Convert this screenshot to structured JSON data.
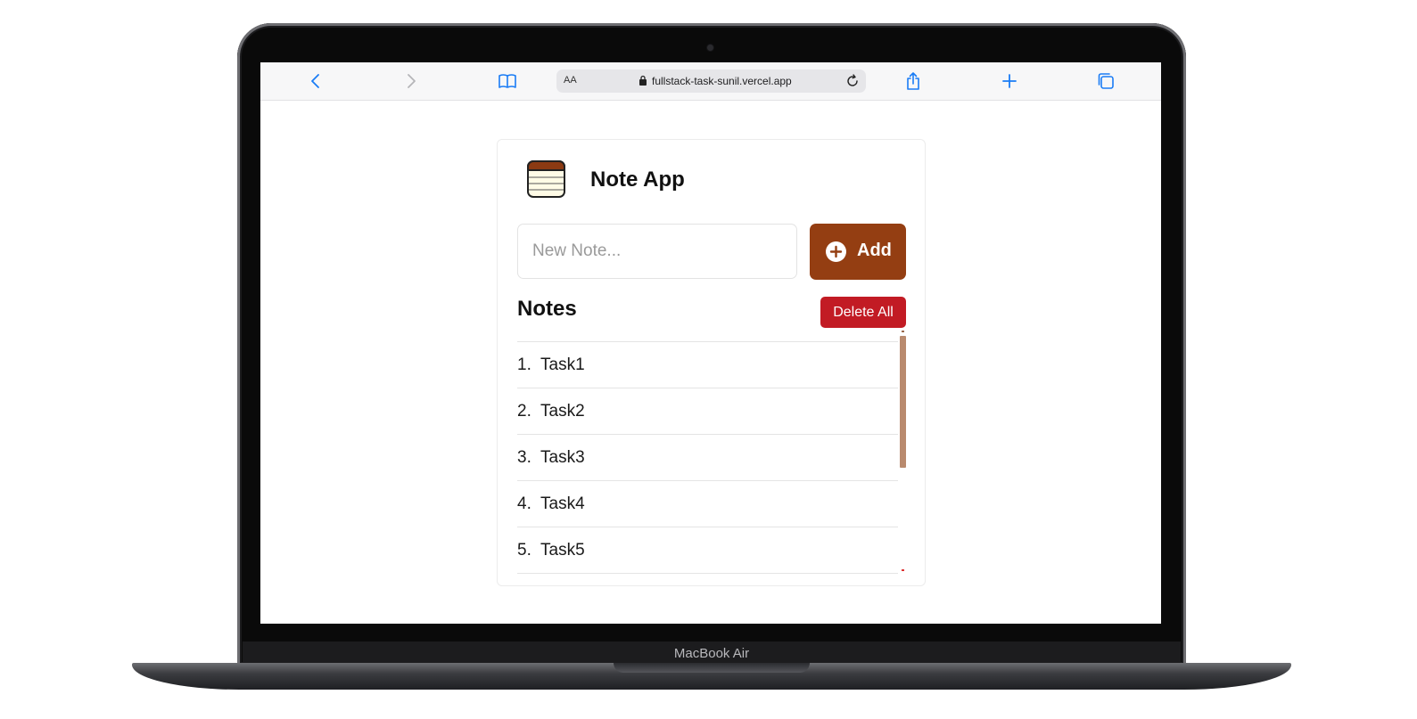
{
  "device": {
    "chin_label": "MacBook Air"
  },
  "browser": {
    "url": "fullstack-task-sunil.vercel.app",
    "text_size_button": "AA",
    "accent_color": "#1a7cf5"
  },
  "app": {
    "title": "Note App",
    "input": {
      "placeholder": "New Note...",
      "value": ""
    },
    "add_button": {
      "label": "Add",
      "color": "#943e12"
    },
    "notes_heading": "Notes",
    "delete_all_button": {
      "label": "Delete All",
      "color": "#c21b24"
    },
    "notes": [
      {
        "number": "1.",
        "text": "Task1"
      },
      {
        "number": "2.",
        "text": "Task2"
      },
      {
        "number": "3.",
        "text": "Task3"
      },
      {
        "number": "4.",
        "text": "Task4"
      },
      {
        "number": "5.",
        "text": "Task5"
      }
    ]
  }
}
